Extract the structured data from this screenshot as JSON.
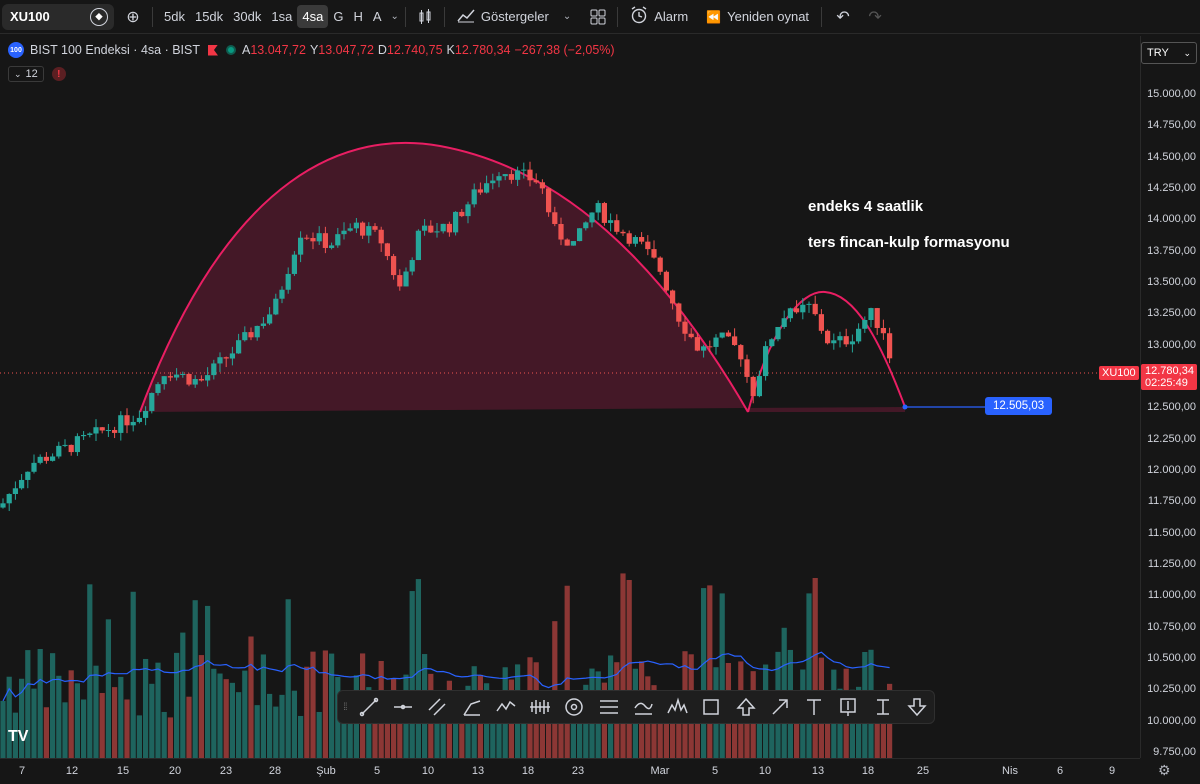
{
  "toolbar": {
    "symbol": "XU100",
    "timeframes": [
      "5dk",
      "15dk",
      "30dk",
      "1sa",
      "4sa",
      "G",
      "H",
      "A"
    ],
    "active_timeframe": "4sa",
    "indicators_label": "Göstergeler",
    "alert_label": "Alarm",
    "replay_label": "Yeniden oynat"
  },
  "legend": {
    "logo_text": "100",
    "title": "BIST 100 Endeksi · 4sa · BIST",
    "open_label": "A",
    "open": "13.047,72",
    "high_label": "Y",
    "high": "13.047,72",
    "low_label": "D",
    "low": "12.740,75",
    "close_label": "K",
    "close": "12.780,34",
    "change": "−267,38 (−2,05%)",
    "collapse_count": "12",
    "error_mark": "!"
  },
  "annotation": {
    "line1": "endeks 4 saatlik",
    "line2": "ters fincan-kulp formasyonu"
  },
  "price_axis": {
    "currency": "TRY",
    "ticks": [
      "15.000,00",
      "14.750,00",
      "14.500,00",
      "14.250,00",
      "14.000,00",
      "13.750,00",
      "13.500,00",
      "13.250,00",
      "13.000,00",
      "12.750,00",
      "12.500,00",
      "12.250,00",
      "12.000,00",
      "11.750,00",
      "11.500,00",
      "11.250,00",
      "11.000,00",
      "10.750,00",
      "10.500,00",
      "10.250,00",
      "10.000,00",
      "9.750,00"
    ],
    "last_symbol": "XU100",
    "last_price": "12.780,34",
    "countdown": "02:25:49",
    "target_price": "12.505,03"
  },
  "time_axis": {
    "labels": [
      "7",
      "12",
      "15",
      "20",
      "23",
      "28",
      "Şub",
      "5",
      "10",
      "13",
      "18",
      "23",
      "Mar",
      "5",
      "10",
      "13",
      "18",
      "25",
      "Nis",
      "6",
      "9"
    ]
  },
  "colors": {
    "up": "#26a69a",
    "down": "#ef5350",
    "arc": "#e91e63",
    "vol_ma": "#2962ff",
    "background": "#161616"
  },
  "drawing_tools": [
    "trend-line-icon",
    "horizontal-line-icon",
    "parallel-channel-icon",
    "pitchfork-icon",
    "zigzag-pattern-icon",
    "ruler-icon",
    "gann-circle-icon",
    "fib-icon",
    "brush-icon",
    "head-shoulders-icon",
    "rectangle-icon",
    "arrow-up-icon",
    "arrow-icon",
    "text-icon",
    "price-label-icon",
    "anchored-text-icon",
    "arrow-down-icon"
  ],
  "chart_data": {
    "type": "candlestick",
    "note_price": 12505.03,
    "last_price": 12780.34,
    "ylim": [
      9750,
      15100
    ]
  }
}
